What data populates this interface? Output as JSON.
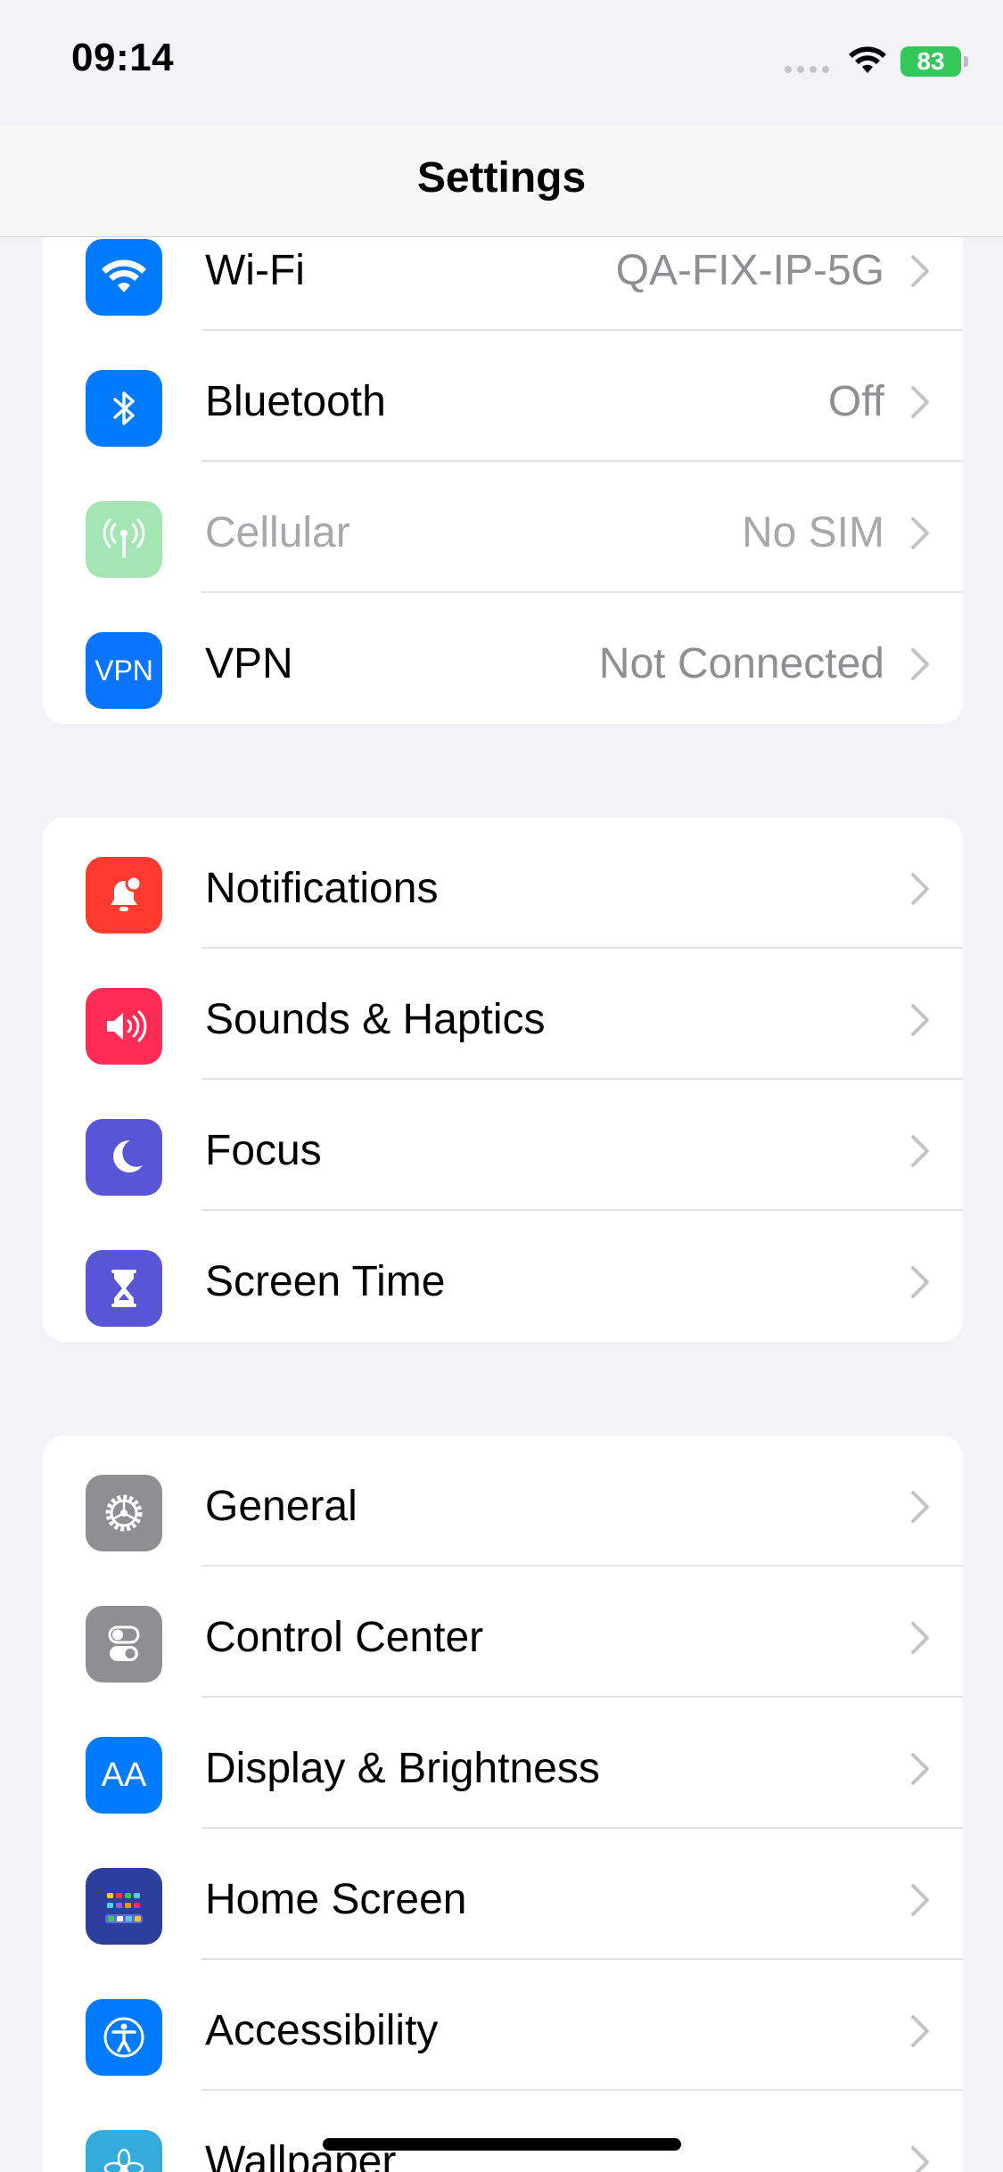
{
  "status_bar": {
    "time": "09:14",
    "battery_level": "83",
    "battery_color": "#34c759"
  },
  "nav": {
    "title": "Settings"
  },
  "groups": [
    {
      "rows": [
        {
          "label": "Wi-Fi",
          "value": "QA-FIX-IP-5G",
          "icon": "wifi-icon",
          "icon_bg": "#007aff"
        },
        {
          "label": "Bluetooth",
          "value": "Off",
          "icon": "bluetooth-icon",
          "icon_bg": "#007aff"
        },
        {
          "label": "Cellular",
          "value": "No SIM",
          "icon": "cellular-antenna-icon",
          "icon_bg": "#34c759",
          "disabled": true
        },
        {
          "label": "VPN",
          "value": "Not Connected",
          "icon": "vpn-icon",
          "icon_bg": "#0a74ff",
          "icon_text": "VPN"
        }
      ]
    },
    {
      "rows": [
        {
          "label": "Notifications",
          "icon": "bell-icon",
          "icon_bg": "#ff3b30"
        },
        {
          "label": "Sounds & Haptics",
          "icon": "speaker-icon",
          "icon_bg": "#ff2d55"
        },
        {
          "label": "Focus",
          "icon": "moon-icon",
          "icon_bg": "#5856d6"
        },
        {
          "label": "Screen Time",
          "icon": "hourglass-icon",
          "icon_bg": "#5856d6"
        }
      ]
    },
    {
      "rows": [
        {
          "label": "General",
          "icon": "gear-icon",
          "icon_bg": "#8e8e93"
        },
        {
          "label": "Control Center",
          "icon": "toggles-icon",
          "icon_bg": "#8e8e93"
        },
        {
          "label": "Display & Brightness",
          "icon": "text-size-icon",
          "icon_bg": "#007aff",
          "icon_text": "AA"
        },
        {
          "label": "Home Screen",
          "icon": "app-grid-icon",
          "icon_bg": "#2c3e9e"
        },
        {
          "label": "Accessibility",
          "icon": "accessibility-icon",
          "icon_bg": "#007aff"
        },
        {
          "label": "Wallpaper",
          "icon": "flower-icon",
          "icon_bg": "#35aadc"
        }
      ]
    }
  ]
}
